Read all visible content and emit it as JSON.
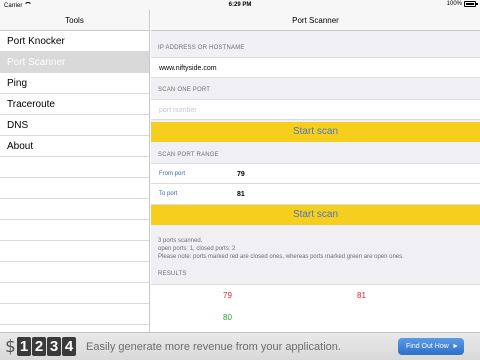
{
  "status_bar": {
    "carrier": "Carrier",
    "time": "6:29 PM",
    "battery": "100%"
  },
  "sidebar": {
    "title": "Tools",
    "items": [
      {
        "label": "Port Knocker"
      },
      {
        "label": "Port Scanner"
      },
      {
        "label": "Ping"
      },
      {
        "label": "Traceroute"
      },
      {
        "label": "DNS"
      },
      {
        "label": "About"
      }
    ],
    "selected_index": 1
  },
  "main": {
    "title": "Port Scanner",
    "host_section_label": "IP ADDRESS OR HOSTNAME",
    "host_value": "www.niftyside.com",
    "single_port_label": "SCAN ONE PORT",
    "port_placeholder": "port number",
    "start_scan_label": "Start scan",
    "range_label": "SCAN PORT RANGE",
    "from_port_label": "From port",
    "from_port_value": "79",
    "to_port_label": "To port",
    "to_port_value": "81",
    "start_scan_range_label": "Start scan",
    "summary_line1": "3 ports scanned.",
    "summary_line2": "open ports: 1, closed ports: 2",
    "summary_line3": "Please note: ports marked red are closed ones, whereas ports marked green are open ones.",
    "results_label": "RESULTS",
    "results": [
      {
        "port": "79",
        "status": "closed"
      },
      {
        "port": "81",
        "status": "closed"
      },
      {
        "port": "80",
        "status": "open"
      }
    ]
  },
  "ad": {
    "currency_symbol": "$",
    "digits": [
      "1",
      "2",
      "3",
      "4"
    ],
    "text": "Easily generate more revenue from your application.",
    "cta_label": "Find Out How",
    "cta_icon": "chevron-right-icon"
  },
  "colors": {
    "accent_yellow": "#f6cf1e",
    "button_text_blue": "#4a77c9",
    "closed_red": "#d3262b",
    "open_green": "#2f9e2f",
    "cta_blue": "#2e6fc8"
  }
}
